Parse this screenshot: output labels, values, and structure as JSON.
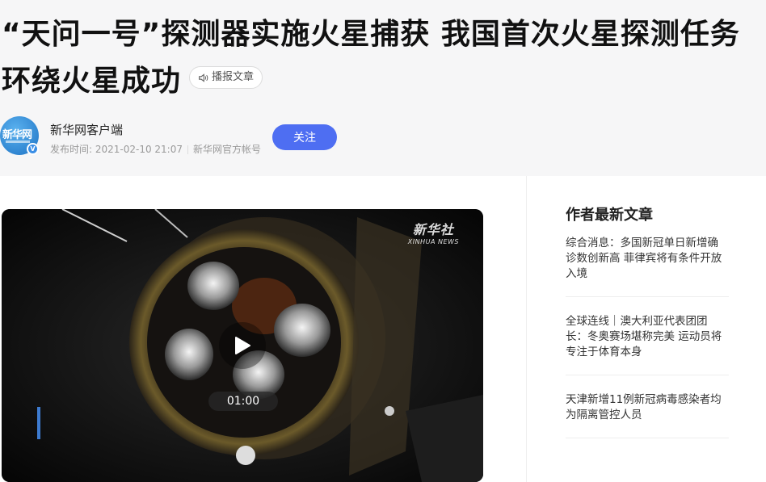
{
  "article": {
    "title": "“天问一号”探测器实施火星捕获 我国首次火星探测任务环绕火星成功",
    "listen_label": "播报文章",
    "author": {
      "avatar_text": "新华网",
      "name": "新华网客户端",
      "publish_time": "发布时间: 2021-02-10 21:07",
      "account_type": "新华网官方帐号",
      "follow_label": "关注"
    },
    "video": {
      "duration": "01:00",
      "watermark_main": "新华社",
      "watermark_sub": "XINHUA NEWS"
    }
  },
  "sidebar": {
    "title": "作者最新文章",
    "items": [
      {
        "label": "综合消息：多国新冠单日新增确诊数创新高 菲律宾将有条件开放入境"
      },
      {
        "label": "全球连线｜澳大利亚代表团团长：冬奥赛场堪称完美 运动员将专注于体育本身"
      },
      {
        "label": "天津新增11例新冠病毒感染者均为隔离管控人员"
      }
    ]
  },
  "colors": {
    "follow_button": "#4e6ef2",
    "header_background": "#f6f6f7"
  },
  "icons": {
    "listen": "speaker-icon",
    "play": "play-icon",
    "verified": "verified-badge-icon"
  }
}
